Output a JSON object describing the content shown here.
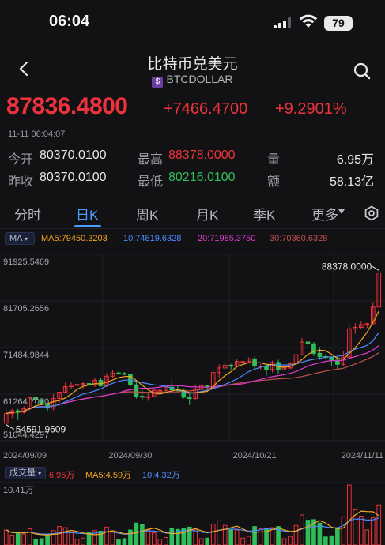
{
  "status_bar": {
    "time": "06:04",
    "battery": "79"
  },
  "header": {
    "title": "比特币兑美元",
    "subtitle": "BTCDOLLAR",
    "currency_badge": "$"
  },
  "quote": {
    "price": "87836.4800",
    "change": "+7466.4700",
    "change_pct": "+9.2901%",
    "timestamp": "11-11 06:04:07"
  },
  "stats": {
    "open_label": "今开",
    "open": "80370.0100",
    "high_label": "最高",
    "high": "88378.0000",
    "volume_label": "量",
    "volume": "6.95万",
    "prev_close_label": "昨收",
    "prev_close": "80370.0100",
    "low_label": "最低",
    "low": "80216.0100",
    "amount_label": "额",
    "amount": "58.13亿"
  },
  "tabs": [
    "分时",
    "日K",
    "周K",
    "月K",
    "季K",
    "更多"
  ],
  "active_tab": "日K",
  "ma_legend": {
    "selector": "MA",
    "ma5": "MA5:79450.3203",
    "ma10": "10:74819.6328",
    "ma20": "20:71985.3750",
    "ma30": "30:70360.6328"
  },
  "vol_legend": {
    "selector": "成交量",
    "vol": "6.95万",
    "ma5": "MA5:4.59万",
    "ma10": "10:4.32万",
    "max_label": "10.41万"
  },
  "colors": {
    "up": "#f0323c",
    "down": "#2fbf5a",
    "accent": "#4a9cff",
    "ma5": "#f5a623",
    "ma10": "#4a8cff",
    "ma20": "#e23ad0",
    "ma30": "#c0504d"
  },
  "chart_data": {
    "type": "candlestick",
    "y_axis_labels": [
      "91925.5469",
      "81705.2656",
      "71484.9844",
      "61264.7070",
      "51044.4297"
    ],
    "ylim": [
      51044.4297,
      91925.5469
    ],
    "x_axis_labels": [
      "2024/09/09",
      "2024/09/30",
      "2024/10/21",
      "2024/11/11"
    ],
    "max_annotation": "88378.0000",
    "min_annotation": "54591.9609",
    "candles": [
      {
        "date": "2024/09/09",
        "o": 54900,
        "h": 58100,
        "l": 54592,
        "c": 57000
      },
      {
        "date": "2024/09/10",
        "o": 57000,
        "h": 58000,
        "l": 56000,
        "c": 57600
      },
      {
        "date": "2024/09/11",
        "o": 57600,
        "h": 58000,
        "l": 55600,
        "c": 57300
      },
      {
        "date": "2024/09/12",
        "o": 57300,
        "h": 58600,
        "l": 57000,
        "c": 58100
      },
      {
        "date": "2024/09/13",
        "o": 58100,
        "h": 60600,
        "l": 57700,
        "c": 60500
      },
      {
        "date": "2024/09/14",
        "o": 60500,
        "h": 60700,
        "l": 59600,
        "c": 60000
      },
      {
        "date": "2024/09/15",
        "o": 60000,
        "h": 60300,
        "l": 58800,
        "c": 59100
      },
      {
        "date": "2024/09/16",
        "o": 59100,
        "h": 59300,
        "l": 57600,
        "c": 58200
      },
      {
        "date": "2024/09/17",
        "o": 58200,
        "h": 61300,
        "l": 57700,
        "c": 60300
      },
      {
        "date": "2024/09/18",
        "o": 60300,
        "h": 61700,
        "l": 59300,
        "c": 61700
      },
      {
        "date": "2024/09/19",
        "o": 61700,
        "h": 63800,
        "l": 61500,
        "c": 62900
      },
      {
        "date": "2024/09/20",
        "o": 62900,
        "h": 64000,
        "l": 62400,
        "c": 63200
      },
      {
        "date": "2024/09/21",
        "o": 63200,
        "h": 63500,
        "l": 62700,
        "c": 63400
      },
      {
        "date": "2024/09/22",
        "o": 63400,
        "h": 64000,
        "l": 62500,
        "c": 63600
      },
      {
        "date": "2024/09/23",
        "o": 63600,
        "h": 64700,
        "l": 62800,
        "c": 63300
      },
      {
        "date": "2024/09/24",
        "o": 63300,
        "h": 64800,
        "l": 62800,
        "c": 64300
      },
      {
        "date": "2024/09/25",
        "o": 64300,
        "h": 64800,
        "l": 62900,
        "c": 63100
      },
      {
        "date": "2024/09/26",
        "o": 63100,
        "h": 65900,
        "l": 62800,
        "c": 65200
      },
      {
        "date": "2024/09/27",
        "o": 65200,
        "h": 66500,
        "l": 64800,
        "c": 65900
      },
      {
        "date": "2024/09/28",
        "o": 65900,
        "h": 66200,
        "l": 65500,
        "c": 65800
      },
      {
        "date": "2024/09/29",
        "o": 65800,
        "h": 66100,
        "l": 65400,
        "c": 65600
      },
      {
        "date": "2024/09/30",
        "o": 65600,
        "h": 65600,
        "l": 62900,
        "c": 63300
      },
      {
        "date": "2024/10/01",
        "o": 63300,
        "h": 64100,
        "l": 60300,
        "c": 60800
      },
      {
        "date": "2024/10/02",
        "o": 60800,
        "h": 62400,
        "l": 59900,
        "c": 60600
      },
      {
        "date": "2024/10/03",
        "o": 60600,
        "h": 61500,
        "l": 59800,
        "c": 60700
      },
      {
        "date": "2024/10/04",
        "o": 60700,
        "h": 62500,
        "l": 60500,
        "c": 62100
      },
      {
        "date": "2024/10/05",
        "o": 62100,
        "h": 62400,
        "l": 61700,
        "c": 62100
      },
      {
        "date": "2024/10/06",
        "o": 62100,
        "h": 62900,
        "l": 61800,
        "c": 62800
      },
      {
        "date": "2024/10/07",
        "o": 62800,
        "h": 64500,
        "l": 62200,
        "c": 62200
      },
      {
        "date": "2024/10/08",
        "o": 62200,
        "h": 63200,
        "l": 61800,
        "c": 62100
      },
      {
        "date": "2024/10/09",
        "o": 62100,
        "h": 62500,
        "l": 60300,
        "c": 60600
      },
      {
        "date": "2024/10/10",
        "o": 60600,
        "h": 61300,
        "l": 58900,
        "c": 60300
      },
      {
        "date": "2024/10/11",
        "o": 60300,
        "h": 63400,
        "l": 60100,
        "c": 62400
      },
      {
        "date": "2024/10/12",
        "o": 62400,
        "h": 63400,
        "l": 62300,
        "c": 63200
      },
      {
        "date": "2024/10/13",
        "o": 63200,
        "h": 63300,
        "l": 62100,
        "c": 62800
      },
      {
        "date": "2024/10/14",
        "o": 62800,
        "h": 66400,
        "l": 62400,
        "c": 66000
      },
      {
        "date": "2024/10/15",
        "o": 66000,
        "h": 67800,
        "l": 64800,
        "c": 67000
      },
      {
        "date": "2024/10/16",
        "o": 67000,
        "h": 68300,
        "l": 66700,
        "c": 67600
      },
      {
        "date": "2024/10/17",
        "o": 67600,
        "h": 67900,
        "l": 66700,
        "c": 67400
      },
      {
        "date": "2024/10/18",
        "o": 67400,
        "h": 68900,
        "l": 67100,
        "c": 68400
      },
      {
        "date": "2024/10/19",
        "o": 68400,
        "h": 68600,
        "l": 68100,
        "c": 68400
      },
      {
        "date": "2024/10/20",
        "o": 68400,
        "h": 69300,
        "l": 68100,
        "c": 69000
      },
      {
        "date": "2024/10/21",
        "o": 69000,
        "h": 69500,
        "l": 66700,
        "c": 67400
      },
      {
        "date": "2024/10/22",
        "o": 67400,
        "h": 67800,
        "l": 66700,
        "c": 67400
      },
      {
        "date": "2024/10/23",
        "o": 67400,
        "h": 67500,
        "l": 65300,
        "c": 66700
      },
      {
        "date": "2024/10/24",
        "o": 66700,
        "h": 68600,
        "l": 66000,
        "c": 68200
      },
      {
        "date": "2024/10/25",
        "o": 68200,
        "h": 68800,
        "l": 65600,
        "c": 66600
      },
      {
        "date": "2024/10/26",
        "o": 66600,
        "h": 67500,
        "l": 66500,
        "c": 67000
      },
      {
        "date": "2024/10/27",
        "o": 67000,
        "h": 68300,
        "l": 66800,
        "c": 68000
      },
      {
        "date": "2024/10/28",
        "o": 68000,
        "h": 70200,
        "l": 67600,
        "c": 69900
      },
      {
        "date": "2024/10/29",
        "o": 69900,
        "h": 73600,
        "l": 69800,
        "c": 72700
      },
      {
        "date": "2024/10/30",
        "o": 72700,
        "h": 72900,
        "l": 71500,
        "c": 72300
      },
      {
        "date": "2024/10/31",
        "o": 72300,
        "h": 72700,
        "l": 69600,
        "c": 70200
      },
      {
        "date": "2024/11/01",
        "o": 70200,
        "h": 71600,
        "l": 68800,
        "c": 69500
      },
      {
        "date": "2024/11/02",
        "o": 69500,
        "h": 69900,
        "l": 69000,
        "c": 69300
      },
      {
        "date": "2024/11/03",
        "o": 69300,
        "h": 69400,
        "l": 67500,
        "c": 68700
      },
      {
        "date": "2024/11/04",
        "o": 68700,
        "h": 69500,
        "l": 66800,
        "c": 67800
      },
      {
        "date": "2024/11/05",
        "o": 67800,
        "h": 70600,
        "l": 67500,
        "c": 69400
      },
      {
        "date": "2024/11/06",
        "o": 69400,
        "h": 76400,
        "l": 69300,
        "c": 75600
      },
      {
        "date": "2024/11/07",
        "o": 75600,
        "h": 76800,
        "l": 74500,
        "c": 75900
      },
      {
        "date": "2024/11/08",
        "o": 75900,
        "h": 77200,
        "l": 75500,
        "c": 76500
      },
      {
        "date": "2024/11/09",
        "o": 76500,
        "h": 76900,
        "l": 75800,
        "c": 76700
      },
      {
        "date": "2024/11/10",
        "o": 76700,
        "h": 81500,
        "l": 76500,
        "c": 80370
      },
      {
        "date": "2024/11/11",
        "o": 80370,
        "h": 88378,
        "l": 80216,
        "c": 87836
      }
    ],
    "volume_unit": "万",
    "volume_ylim": [
      0,
      10.41
    ],
    "volumes": [
      2.6,
      1.7,
      2.2,
      1.9,
      2.8,
      1.0,
      1.1,
      1.9,
      2.5,
      3.2,
      3.0,
      2.1,
      1.0,
      1.2,
      2.2,
      2.5,
      2.4,
      3.1,
      2.2,
      0.9,
      1.1,
      2.6,
      3.8,
      3.5,
      2.6,
      2.1,
      1.0,
      1.3,
      2.9,
      2.7,
      2.8,
      3.1,
      2.7,
      1.1,
      1.2,
      3.6,
      4.2,
      3.4,
      2.6,
      2.6,
      1.2,
      1.5,
      3.2,
      2.8,
      2.9,
      3.0,
      3.2,
      1.1,
      1.5,
      3.4,
      5.2,
      4.3,
      4.4,
      3.8,
      1.4,
      1.6,
      3.0,
      4.9,
      10.4,
      6.1,
      5.0,
      2.6,
      4.7,
      6.95
    ]
  }
}
